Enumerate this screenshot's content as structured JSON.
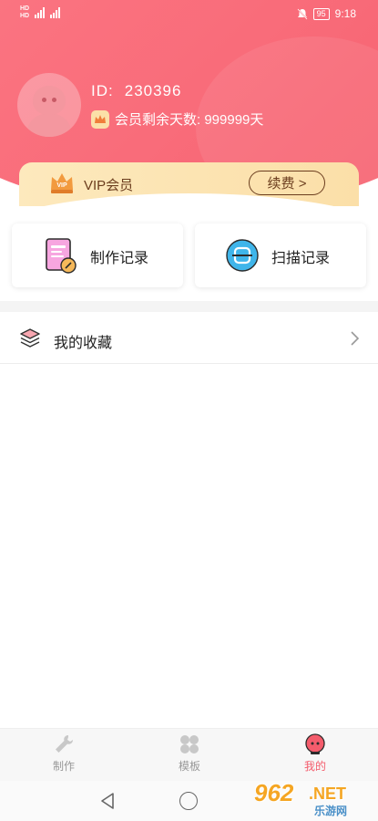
{
  "status_bar": {
    "hd1": "HD",
    "hd2": "HD",
    "time": "9:18",
    "battery": "95"
  },
  "profile": {
    "id_label": "ID:",
    "id_value": "230396",
    "member_days": "会员剩余天数: 999999天"
  },
  "vip": {
    "badge": "VIP",
    "label": "VIP会员",
    "renew_label": "续费 >"
  },
  "cards": {
    "make_records": "制作记录",
    "scan_records": "扫描记录"
  },
  "favorites": {
    "label": "我的收藏"
  },
  "tabbar": {
    "items": [
      {
        "label": "制作",
        "active": false
      },
      {
        "label": "模板",
        "active": false
      },
      {
        "label": "我的",
        "active": true
      }
    ]
  },
  "watermark": {
    "number": "962",
    "net": ".NET",
    "sub": "乐游网"
  },
  "colors": {
    "header": "#f96c7a",
    "vip_bg": "#fbdfa8",
    "vip_text": "#6b3d1e",
    "active_tab": "#f45c6c"
  },
  "icons": {
    "avatar": "avatar-icon",
    "crown": "crown-icon",
    "make": "document-edit-icon",
    "scan": "scan-icon",
    "favorites": "layers-icon",
    "chevron": "chevron-right-icon",
    "tab_make": "wrench-icon",
    "tab_template": "clover-grid-icon",
    "tab_mine": "user-face-icon",
    "nav_back": "back-triangle-icon",
    "nav_home": "home-circle-icon"
  }
}
